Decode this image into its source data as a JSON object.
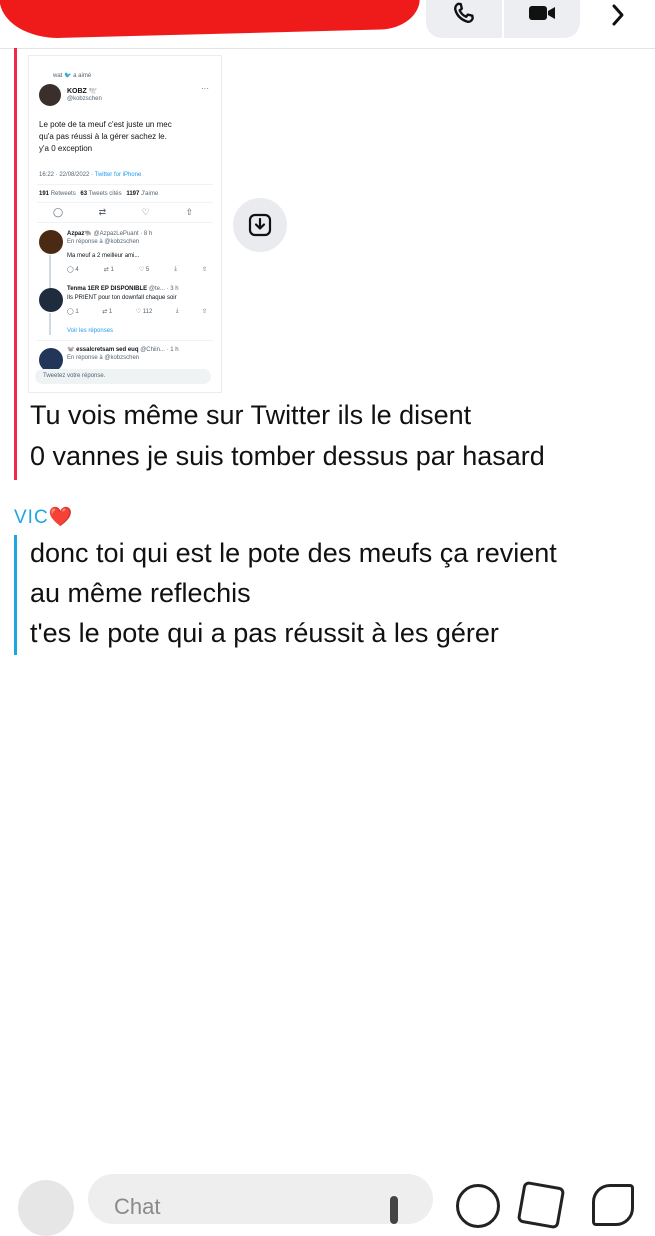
{
  "header": {
    "icons": [
      "phone-icon",
      "video-icon",
      "chevron-right-icon"
    ]
  },
  "tweet": {
    "liked_by": "wat 🐦 a aimé",
    "author_name": "KOBZ 🕊️",
    "author_handle": "@kobzschen",
    "text_line1": "Le pote de ta meuf c'est juste un mec",
    "text_line2": "qu'a pas réussi à la gérer sachez le.",
    "text_line3": "y'a 0 exception",
    "timestamp": "16:22 · 22/08/2022 · ",
    "source": "Twitter for iPhone",
    "retweets_count": "191",
    "retweets_label": "Retweets",
    "quotes_count": "63",
    "quotes_label": "Tweets cités",
    "likes_count": "1197",
    "likes_label": "J'aime",
    "replies": [
      {
        "name": "Azpaz🐃",
        "handle": "@AzpazLePuant · 8 h",
        "reply_to": "En réponse à @kobzschen",
        "text": "Ma meuf a 2 meilleur ami...",
        "c1": "4",
        "c2": "1",
        "c3": "5"
      },
      {
        "name": "Tenma 1ER EP DISPONIBLE",
        "handle": "@te... · 3 h",
        "reply_to": "",
        "text": "Ils PRIENT pour ton downfall chaque soir",
        "c1": "1",
        "c2": "1",
        "c3": "112"
      }
    ],
    "see_replies": "Voir les réponses",
    "last_reply_name": "🐭 essalcretsam sed euq",
    "last_reply_handle": "@Chiin... · 1 h",
    "last_reply_to": "En réponse à @kobzschen",
    "reply_placeholder": "Tweetez votre réponse."
  },
  "messages": {
    "me_line1": "Tu vois même sur Twitter ils le disent",
    "me_line2": "0 vannes je suis tomber dessus par hasard",
    "sender_name": "VIC❤️",
    "vic_line1": "donc toi qui est le pote des meufs ça revient",
    "vic_line2": "au même reflechis",
    "vic_line3": "t'es le pote qui a pas réussit à les gérer"
  },
  "composer": {
    "placeholder": "Chat"
  },
  "colors": {
    "me_accent": "#f02849",
    "friend_accent": "#1fa6e0",
    "twitter_blue": "#1d9bf0"
  }
}
